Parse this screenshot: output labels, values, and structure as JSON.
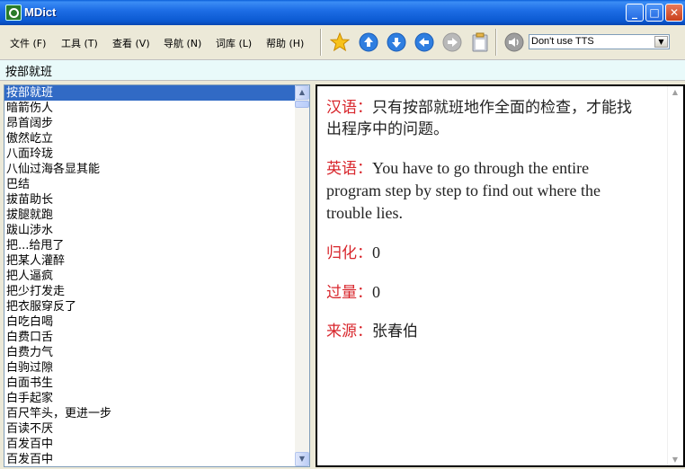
{
  "window": {
    "title": "MDict"
  },
  "menu": [
    {
      "label": "文件 (F)"
    },
    {
      "label": "工具 (T)"
    },
    {
      "label": "查看 (V)"
    },
    {
      "label": "导航 (N)"
    },
    {
      "label": "词库 (L)"
    },
    {
      "label": "帮助 (H)"
    }
  ],
  "toolbar": {
    "icons": [
      "favorite-star-icon",
      "up-arrow-icon",
      "down-arrow-icon",
      "back-arrow-icon",
      "forward-arrow-icon",
      "clipboard-icon",
      "speaker-icon"
    ],
    "tts_selected": "Don't use TTS"
  },
  "search": {
    "value": "按部就班"
  },
  "wordlist": {
    "items": [
      "按部就班",
      "暗箭伤人",
      "昂首阔步",
      "傲然屹立",
      "八面玲珑",
      "八仙过海各显其能",
      "巴结",
      "拔苗助长",
      "拔腿就跑",
      "跋山涉水",
      "把...给甩了",
      "把某人灌醉",
      "把人逼疯",
      "把少打发走",
      "把衣服穿反了",
      "白吃白喝",
      "白费口舌",
      "白费力气",
      "白驹过隙",
      "白面书生",
      "白手起家",
      "百尺竿头，更进一步",
      "百读不厌",
      "百发百中",
      "百发百中"
    ],
    "selected_index": 0
  },
  "entry": {
    "chinese_label": "汉语：",
    "chinese_text": "只有按部就班地作全面的检查，才能找出程序中的问题。",
    "english_label": "英语：",
    "english_text": "You have to go through the entire program step by step to find out where the trouble lies.",
    "guihua_label": "归化：",
    "guihua_value": "0",
    "guoliang_label": "过量：",
    "guoliang_value": "0",
    "source_label": "来源：",
    "source_value": "张春伯"
  },
  "colors": {
    "label_red": "#d8262c",
    "selection_blue": "#316ac5",
    "title_blue": "#0a58d0"
  }
}
